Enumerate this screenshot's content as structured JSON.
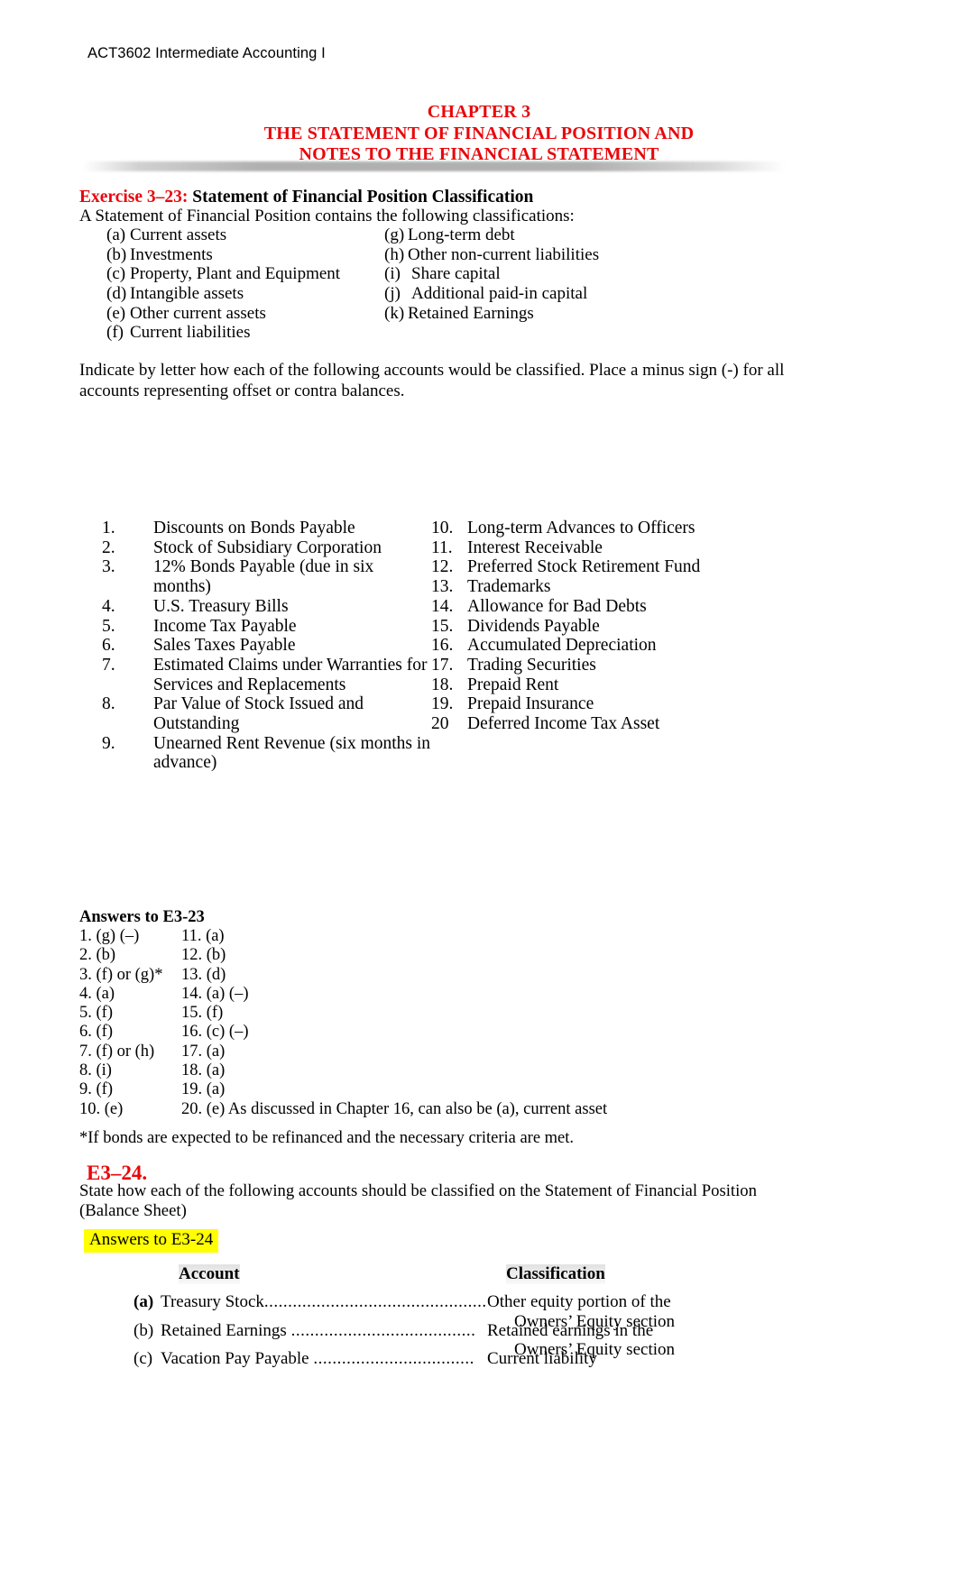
{
  "header": {
    "course": "ACT3602 Intermediate Accounting I"
  },
  "title": {
    "line1": "CHAPTER 3",
    "line2": "THE STATEMENT OF FINANCIAL POSITION AND",
    "line3": "NOTES TO THE FINANCIAL STATEMENT",
    "color": "#e8070b"
  },
  "exercise_3_23": {
    "label": "Exercise 3–23:",
    "title": " Statement of Financial Position Classification",
    "intro": "A Statement of Financial Position contains the following classifications:",
    "classifications": [
      {
        "left_tag": "(a)",
        "left_text": "Current assets",
        "right_tag": "(g)",
        "right_text": "Long-term debt"
      },
      {
        "left_tag": "(b)",
        "left_text": "Investments",
        "right_tag": "(h)",
        "right_text": "Other non-current liabilities"
      },
      {
        "left_tag": "(c)",
        "left_text": "Property, Plant and Equipment",
        "right_tag": "(i)",
        "right_text": "Share capital"
      },
      {
        "left_tag": "(d)",
        "left_text": "Intangible assets",
        "right_tag": "(j)",
        "right_text": "Additional paid-in capital"
      },
      {
        "left_tag": "(e)",
        "left_text": "Other current assets",
        "right_tag": "(k)",
        "right_text": "Retained Earnings"
      },
      {
        "left_tag": "(f)",
        "left_text": "Current liabilities",
        "right_tag": "",
        "right_text": ""
      }
    ],
    "instruction": "Indicate by letter how each of the following accounts would be classified. Place a minus sign (-) for all accounts representing offset or contra balances.",
    "accounts_left": [
      {
        "num": "1.",
        "line1": "Discounts on Bonds Payable",
        "line2": ""
      },
      {
        "num": "2.",
        "line1": "Stock of Subsidiary Corporation",
        "line2": ""
      },
      {
        "num": "3.",
        "line1": "12% Bonds Payable (due in six",
        "line2": "months)"
      },
      {
        "num": "4.",
        "line1": " U.S. Treasury Bills",
        "line2": ""
      },
      {
        "num": "5.",
        "line1": "Income Tax Payable",
        "line2": ""
      },
      {
        "num": "6.",
        "line1": "Sales Taxes Payable",
        "line2": ""
      },
      {
        "num": "7.",
        "line1": "Estimated Claims under Warranties for",
        "line2": "Services and Replacements"
      },
      {
        "num": "8.",
        "line1": "Par Value of Stock Issued and Outstanding",
        "line2": ""
      },
      {
        "num": "9.",
        "line1": "Unearned Rent Revenue (six months in",
        "line2": "advance)"
      }
    ],
    "accounts_right": [
      {
        "num": "10.",
        "line1": "Long-term Advances to Officers",
        "line2": ""
      },
      {
        "num": "11.",
        "line1": "Interest Receivable",
        "line2": ""
      },
      {
        "num": "12.",
        "line1": "Preferred Stock Retirement Fund",
        "line2": ""
      },
      {
        "num": "13.",
        "line1": "Trademarks",
        "line2": ""
      },
      {
        "num": "14.",
        "line1": " Allowance for Bad Debts",
        "line2": ""
      },
      {
        "num": "15.",
        "line1": " Dividends Payable",
        "line2": ""
      },
      {
        "num": "16.",
        "line1": "Accumulated Depreciation",
        "line2": ""
      },
      {
        "num": "17.",
        "line1": "Trading Securities",
        "line2": ""
      },
      {
        "num": "18.",
        "line1": "Prepaid Rent",
        "line2": ""
      },
      {
        "num": "19.",
        "line1": "Prepaid Insurance",
        "line2": ""
      },
      {
        "num": "20",
        "line1": "Deferred Income Tax Asset",
        "line2": ""
      }
    ]
  },
  "answers_3_23": {
    "heading": "Answers to E3-23",
    "rows": [
      {
        "left": "1. (g) (–)",
        "right": "11. (a)"
      },
      {
        "left": "2. (b)",
        "right": "12. (b)"
      },
      {
        "left": "3. (f) or (g)*",
        "right": "13. (d)"
      },
      {
        "left": "4. (a)",
        "right": "14. (a) (–)"
      },
      {
        "left": "5. (f)",
        "right": "15. (f)"
      },
      {
        "left": "6. (f)",
        "right": "16. (c) (–)"
      },
      {
        "left": "7. (f) or (h)",
        "right": "17. (a)"
      },
      {
        "left": "8. (i)",
        "right": "18. (a)"
      },
      {
        "left": "9. (f)",
        "right": "19. (a)"
      },
      {
        "left": "10. (e)",
        "right": "20. (e) As discussed in Chapter 16, can also be (a), current asset"
      }
    ],
    "footnote": "*If bonds are expected to be refinanced and the necessary criteria are met."
  },
  "exercise_3_24": {
    "heading": "E3–24.",
    "intro": "State how each of the following accounts should be classified on the Statement of Financial Position (Balance Sheet)",
    "answers_label": "Answers to E3-24",
    "highlight_color": "#ffff00",
    "table": {
      "col_account": "Account",
      "col_classification": "Classification",
      "rows": [
        {
          "label": "(a)",
          "label_bold": true,
          "account": "Treasury Stock",
          "dots": "...............................................",
          "class_line1": "Other equity portion of the",
          "class_line2": "Owners’ Equity section"
        },
        {
          "label": "(b)",
          "label_bold": false,
          "account": "Retained Earnings ",
          "dots": ".......................................",
          "class_line1": "Retained earnings in the",
          "class_line2": "Owners’ Equity section"
        },
        {
          "label": "(c)",
          "label_bold": false,
          "account": "Vacation Pay Payable ",
          "dots": "..................................",
          "class_line1": "Current liability",
          "class_line2": ""
        }
      ]
    }
  }
}
